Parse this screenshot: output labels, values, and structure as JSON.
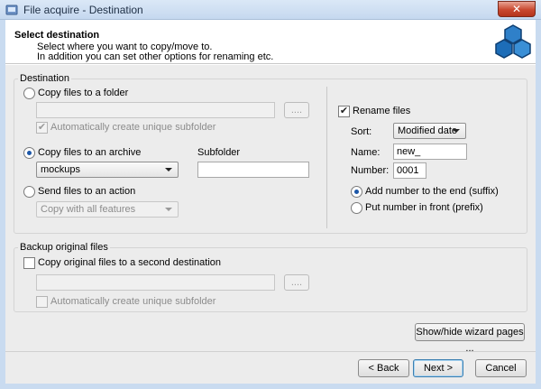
{
  "window": {
    "title": "File acquire - Destination",
    "close_label": "✕"
  },
  "header": {
    "title": "Select destination",
    "line1": "Select where you want to copy/move to.",
    "line2": "In addition you can set other options for renaming etc."
  },
  "destination": {
    "legend": "Destination",
    "copy_to_folder": {
      "label": "Copy files to a folder",
      "selected": false
    },
    "folder_path": "",
    "browse_label": "....",
    "auto_unique_subfolder": {
      "label": "Automatically create unique subfolder",
      "checked": true,
      "enabled": false
    },
    "copy_to_archive": {
      "label": "Copy files to an archive",
      "selected": true
    },
    "archive_value": "mockups",
    "subfolder_label": "Subfolder",
    "subfolder_value": "",
    "send_to_action": {
      "label": "Send files to an action",
      "selected": false
    },
    "action_value": "Copy with all features"
  },
  "rename": {
    "checkbox_label": "Rename files",
    "checked": true,
    "sort_label": "Sort:",
    "sort_value": "Modified date",
    "name_label": "Name:",
    "name_value": "new_",
    "number_label": "Number:",
    "number_value": "0001",
    "suffix_label": "Add number to the end (suffix)",
    "prefix_label": "Put number in front (prefix)",
    "selected_mode": "suffix"
  },
  "backup": {
    "legend": "Backup original files",
    "copy_second": {
      "label": "Copy original files to a second destination",
      "checked": false
    },
    "path": "",
    "browse_label": "....",
    "auto_unique_subfolder": {
      "label": "Automatically create unique subfolder",
      "checked": false,
      "enabled": false
    }
  },
  "buttons": {
    "show_hide": "Show/hide wizard pages ...",
    "back": "< Back",
    "next": "Next >",
    "cancel": "Cancel"
  },
  "icons": {
    "app": "app-icon",
    "header_logo": "hexagon-logo-icon",
    "checkmark": "✔"
  }
}
